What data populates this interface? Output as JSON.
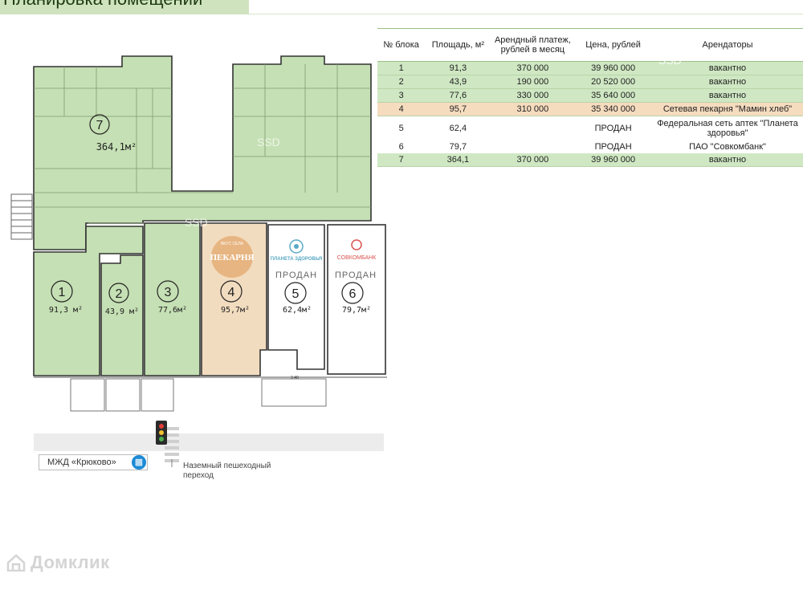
{
  "header": {
    "title": "Планировка помещений"
  },
  "table": {
    "headers": [
      "№ блока",
      "Площадь, м²",
      "Арендный платеж, рублей в месяц",
      "Цена, рублей",
      "Арендаторы"
    ],
    "rows": [
      {
        "block": "1",
        "area": "91,3",
        "rent": "370 000",
        "price": "39 960 000",
        "tenant": "вакантно",
        "style": "green"
      },
      {
        "block": "2",
        "area": "43,9",
        "rent": "190 000",
        "price": "20 520 000",
        "tenant": "вакантно",
        "style": "green"
      },
      {
        "block": "3",
        "area": "77,6",
        "rent": "330 000",
        "price": "35 640 000",
        "tenant": "вакантно",
        "style": "green"
      },
      {
        "block": "4",
        "area": "95,7",
        "rent": "310 000",
        "price": "35 340 000",
        "tenant": "Сетевая пекарня \"Мамин хлеб\"",
        "style": "orange"
      },
      {
        "block": "5",
        "area": "62,4",
        "rent": "",
        "price": "ПРОДАН",
        "tenant": "Федеральная сеть аптек \"Планета здоровья\"",
        "style": "white tall"
      },
      {
        "block": "6",
        "area": "79,7",
        "rent": "",
        "price": "ПРОДАН",
        "tenant": "ПАО \"Совкомбанк\"",
        "style": "white"
      },
      {
        "block": "7",
        "area": "364,1",
        "rent": "370 000",
        "price": "39 960 000",
        "tenant": "вакантно",
        "style": "green"
      }
    ]
  },
  "plan": {
    "units": [
      {
        "num": "7",
        "area": "364,1м²"
      },
      {
        "num": "1",
        "area": "91,3 м²"
      },
      {
        "num": "2",
        "area": "43,9 м²"
      },
      {
        "num": "3",
        "area": "77,6м²"
      },
      {
        "num": "4",
        "area": "95,7м²"
      },
      {
        "num": "5",
        "area": "62,4м²"
      },
      {
        "num": "6",
        "area": "79,7м²"
      }
    ],
    "sold_labels": [
      "ПРОДАН",
      "ПРОДАН"
    ],
    "logos": {
      "bakery_top": "ВКУС СЕЛА",
      "bakery": "ПЕКАРНЯ",
      "pharmacy": "ПЛАНЕТА ЗДОРОВЬЯ",
      "bank": "СОВКОМБАНК"
    },
    "watermark_text": "SSD",
    "dimension": "3.48"
  },
  "legend": {
    "metro": "МЖД «Крюково»",
    "crossing": "Наземный пешеходный переход"
  },
  "watermark": "Домклик",
  "colors": {
    "vacant": "#c5e0b4",
    "bakery": "#f2dcbf",
    "sold": "#ffffff",
    "outline": "#333333"
  }
}
